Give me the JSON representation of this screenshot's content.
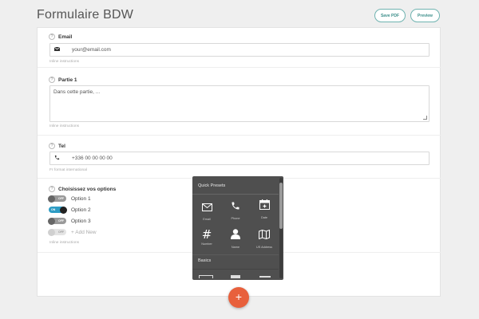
{
  "header": {
    "title": "Formulaire BDW",
    "save_pdf_label": "Save PDF",
    "preview_label": "Preview"
  },
  "fields": {
    "email": {
      "label": "Email",
      "icon": "envelope-icon",
      "value": "your@email.com",
      "hint": "Inline instructions"
    },
    "partie": {
      "label": "Partie 1",
      "value": "Dans cette partie, ...",
      "hint": "Inline instructions"
    },
    "tel": {
      "label": "Tel",
      "icon": "phone-icon",
      "value": "+336 00 00 00 00",
      "hint": "Fr format international"
    },
    "options": {
      "label": "Choisissez vos options",
      "items": [
        {
          "label": "Option 1",
          "state": "OFF"
        },
        {
          "label": "Option 2",
          "state": "ON"
        },
        {
          "label": "Option 3",
          "state": "OFF"
        }
      ],
      "add_new": "+ Add New",
      "add_new_state": "OFF",
      "hint": "Inline instructions"
    }
  },
  "popup": {
    "quick_presets_title": "Quick Presets",
    "presets": [
      {
        "label": "Email",
        "icon": "envelope-icon"
      },
      {
        "label": "Phone",
        "icon": "phone-icon"
      },
      {
        "label": "Date",
        "icon": "calendar-icon"
      },
      {
        "label": "Number",
        "icon": "hash-icon"
      },
      {
        "label": "Name",
        "icon": "person-icon"
      },
      {
        "label": "US Address",
        "icon": "map-icon"
      }
    ],
    "basics_title": "Basics"
  },
  "fab_label": "+",
  "colors": {
    "accent": "#e8603c",
    "teal": "#3d8f8b",
    "toggle_on": "#2e9cc4",
    "popup_bg": "#4f4f4f"
  }
}
